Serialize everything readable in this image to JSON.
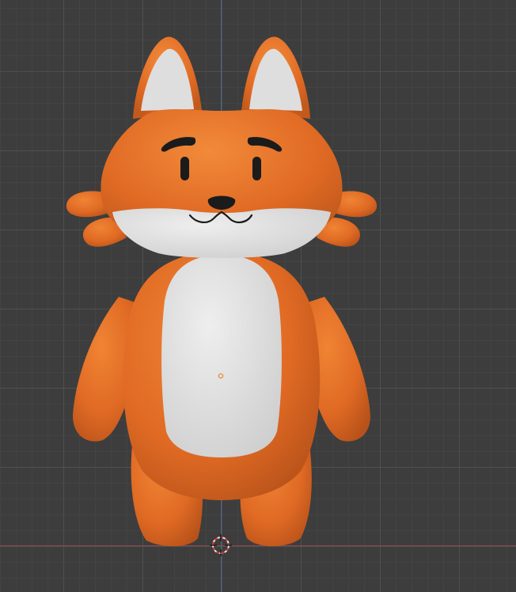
{
  "viewport": {
    "background_color": "#3d3d3d",
    "grid_color": "#505050",
    "axis_x_color": "#8a4a4f",
    "axis_z_color": "#4a6a8a"
  },
  "model": {
    "subject": "fox-character",
    "body_color": "#e06a24",
    "belly_color": "#dadada",
    "ear_inner_color": "#dedede",
    "feature_color": "#1b1b1b"
  },
  "icons": {
    "cursor": "3d-cursor-icon",
    "origin": "object-origin-icon"
  }
}
